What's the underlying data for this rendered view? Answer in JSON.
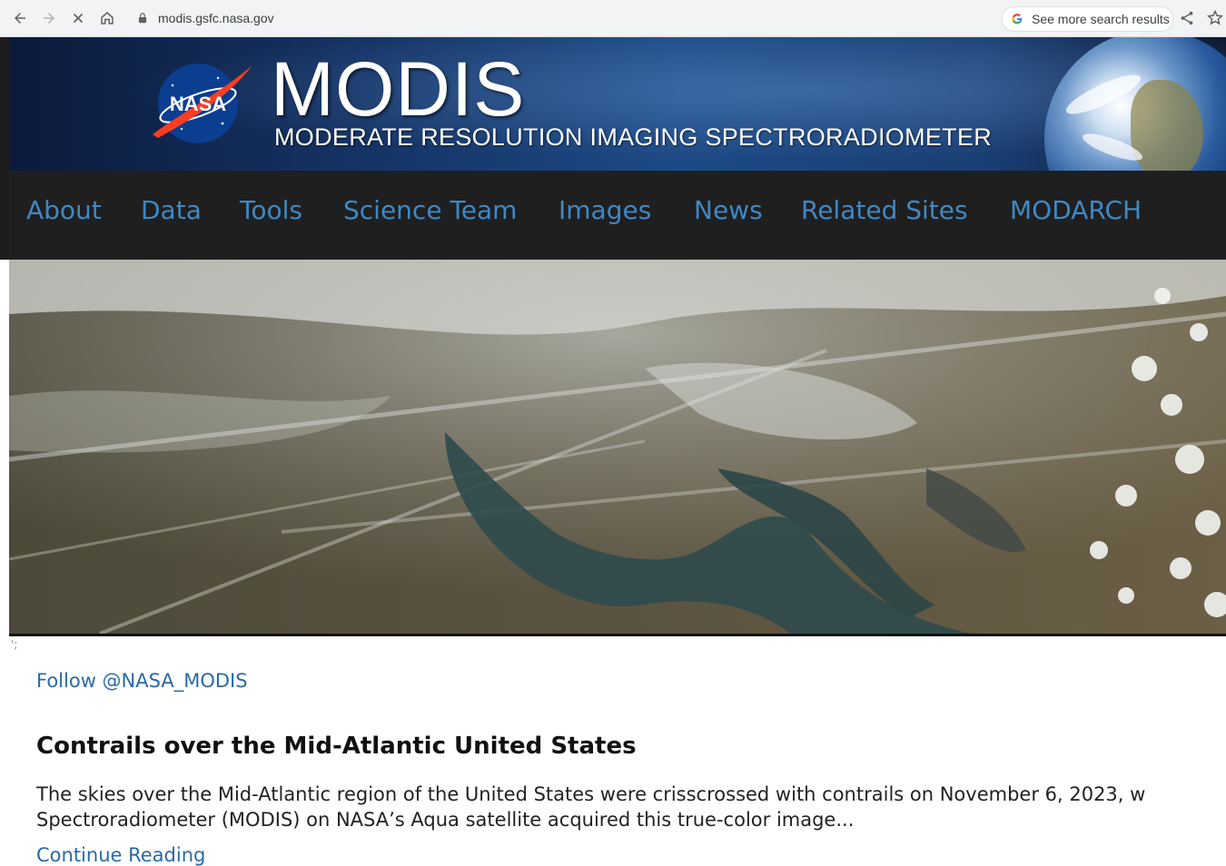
{
  "browser": {
    "url": "modis.gsfc.nasa.gov",
    "search_chip": "See more search results"
  },
  "banner": {
    "logo_text": "NASA",
    "title": "MODIS",
    "subtitle": "MODERATE RESOLUTION IMAGING SPECTRORADIOMETER"
  },
  "nav": {
    "items": [
      {
        "label": "About"
      },
      {
        "label": "Data"
      },
      {
        "label": "Tools"
      },
      {
        "label": "Science Team"
      },
      {
        "label": "Images"
      },
      {
        "label": "News"
      },
      {
        "label": "Related Sites"
      },
      {
        "label": "MODARCH"
      }
    ]
  },
  "content": {
    "stray_mark": "';",
    "follow_link": "Follow @NASA_MODIS",
    "headline": "Contrails over the Mid-Atlantic United States",
    "para_line1": "The skies over the Mid-Atlantic region of the United States were crisscrossed with contrails on November 6, 2023, w",
    "para_line2": "Spectroradiometer (MODIS) on NASA’s Aqua satellite acquired this true-color image...",
    "continue_link": "Continue Reading"
  },
  "colors": {
    "nav_bg": "#1f1f1f",
    "nav_link": "#3f88c5",
    "link": "#2a6aa6",
    "banner_blue": "#1d4a86"
  }
}
